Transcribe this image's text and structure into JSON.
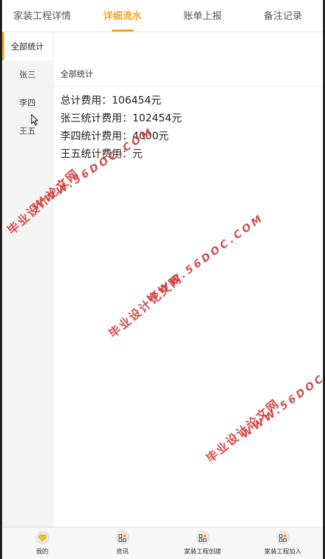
{
  "tabs": [
    {
      "label": "家装工程详情",
      "active": false
    },
    {
      "label": "详细流水",
      "active": true
    },
    {
      "label": "账单上报",
      "active": false
    },
    {
      "label": "备注记录",
      "active": false
    }
  ],
  "sidebar": {
    "items": [
      {
        "label": "全部统计",
        "active": true
      },
      {
        "label": "张三",
        "active": false
      },
      {
        "label": "李四",
        "active": false
      },
      {
        "label": "王五",
        "active": false
      }
    ]
  },
  "content": {
    "section_title": "全部统计",
    "lines": [
      "总计费用：106454元",
      "张三统计费用：102454元",
      "李四统计费用：4000元",
      "王五统计费用：元"
    ]
  },
  "bottom_nav": [
    {
      "label": "我的",
      "icon": "heart-icon"
    },
    {
      "label": "资讯",
      "icon": "grid-icon"
    },
    {
      "label": "家装工程创建",
      "icon": "grid-icon"
    },
    {
      "label": "家装工程加入",
      "icon": "grid-icon"
    }
  ],
  "watermark": {
    "cn": "毕业设计论文网",
    "url": "WWW.56DOC.COM"
  },
  "colors": {
    "accent": "#f5a623",
    "watermark": "#d23a3a"
  }
}
